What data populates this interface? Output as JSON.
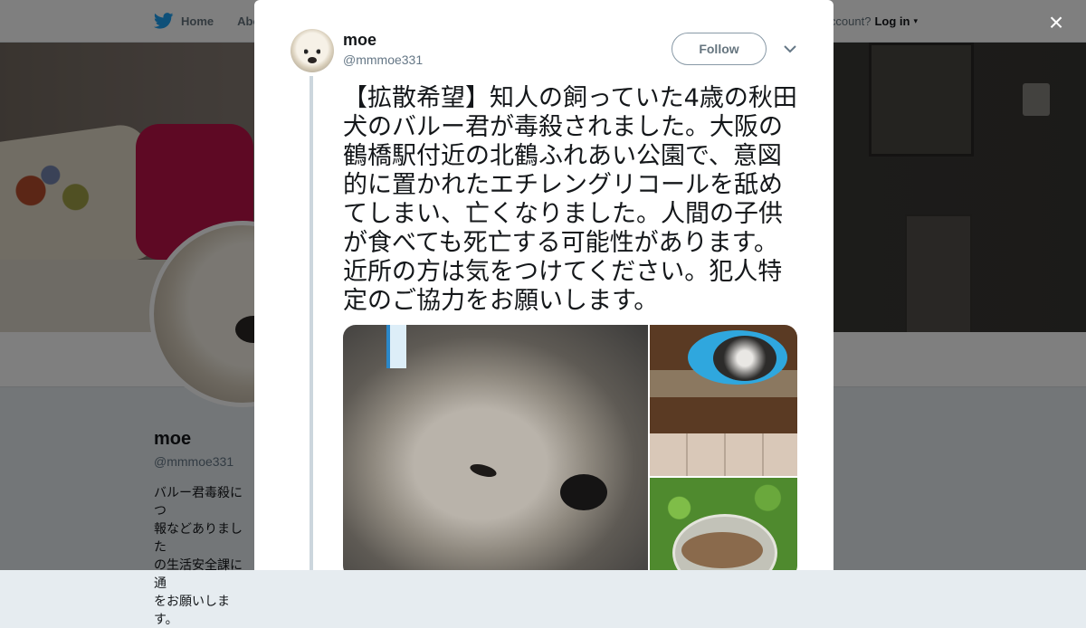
{
  "background_page": {
    "nav": {
      "home_label": "Home",
      "about_label": "Abo",
      "account_prompt": "account?",
      "login_label": "Log in",
      "caret": "▾"
    },
    "profile": {
      "name": "moe",
      "handle": "@mmmoe331",
      "bio": "バルー君毒殺につ\n報などありました\nの生活安全課に通\nをお願いします。"
    }
  },
  "modal": {
    "close_icon": "×",
    "tweet": {
      "author_name": "moe",
      "author_handle": "@mmmoe331",
      "follow_label": "Follow",
      "menu_icon": "chevron-down-icon",
      "text": "【拡散希望】知人の飼っていた4歳の秋田犬のバルー君が毒殺されました。大阪の鶴橋駅付近の北鶴ふれあい公園で、意図的に置かれたエチレングリコールを舐めてしまい、亡くなりました。人間の子供が食べても死亡する可能性があります。近所の方は気をつけてください。犯人特定のご協力をお願いします。",
      "media": [
        {
          "alt": "dog-face-photo"
        },
        {
          "alt": "dog-with-cone-photo"
        },
        {
          "alt": "bowl-in-grass-photo"
        }
      ]
    }
  },
  "colors": {
    "twitter_blue": "#1da1f2",
    "text_primary": "#14171a",
    "text_secondary": "#657786",
    "overlay": "rgba(0,0,0,0.5)"
  }
}
